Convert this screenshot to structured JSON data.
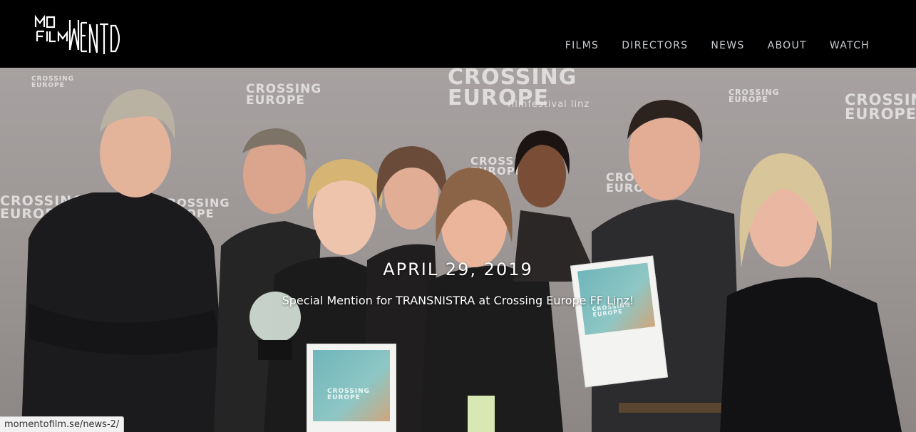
{
  "brand": {
    "logo_text": "MOMENTO FILM"
  },
  "nav": {
    "items": [
      "FILMS",
      "DIRECTORS",
      "NEWS",
      "ABOUT",
      "WATCH"
    ]
  },
  "hero": {
    "date": "APRIL 29, 2019",
    "title": "Special Mention for TRANSNISTRA at Crossing Europe FF Linz!",
    "backdrop_texts": [
      "CROSSING EUROPE",
      "filmfestival linz"
    ],
    "poster_text": "CROSSING EUROPE"
  },
  "status_bar": {
    "url": "momentofilm.se/news-2/"
  }
}
